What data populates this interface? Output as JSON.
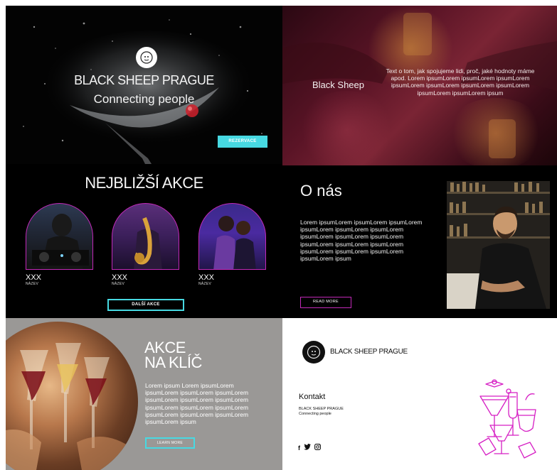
{
  "hero": {
    "title": "BLACK SHEEP PRAGUE",
    "subtitle": "Connecting people",
    "reserve_label": "REZERVACE",
    "logo_icon": "sheep-logo-icon"
  },
  "banner": {
    "brand": "Black Sheep",
    "text": "Text o tom, jak spojujeme lidi, proč, jaké hodnoty máme apod. Lorem ipsumLorem ipsumLorem ipsumLorem ipsumLorem ipsumLorem ipsumLorem ipsumLorem ipsumLorem ipsumLorem ipsum"
  },
  "events": {
    "heading": "NEJBLIŽŠÍ AKCE",
    "cards": [
      {
        "name": "XXX",
        "label": "NÁZEV"
      },
      {
        "name": "XXX",
        "label": "NÁZEV"
      },
      {
        "name": "XXX",
        "label": "NÁZEV"
      }
    ],
    "next_label": "DALŠÍ AKCE"
  },
  "about": {
    "heading": "O nás",
    "text": "Lorem ipsumLorem ipsumLorem ipsumLorem ipsumLorem ipsumLorem ipsumLorem ipsumLorem ipsumLorem ipsumLorem ipsumLorem ipsumLorem ipsumLorem ipsumLorem ipsumLorem ipsumLorem ipsumLorem ipsum",
    "read_more_label": "READ MORE"
  },
  "private_events": {
    "heading_line1": "AKCE",
    "heading_line2": "NA KLÍČ",
    "text": "Lorem ipsum Lorem ipsumLorem ipsumLorem ipsumLorem ipsumLorem ipsumLorem ipsumLorem ipsumLorem ipsumLorem ipsumLorem ipsumLorem ipsumLorem ipsumLorem ipsumLorem ipsumLorem ipsum",
    "learn_more_label": "LEARN MORE"
  },
  "footer": {
    "brand": "BLACK SHEEP PRAGUE",
    "contact_heading": "Kontakt",
    "contact_line1": "BLACK SHEEP PRAGUE",
    "contact_line2": "Connecting people",
    "social": [
      "f",
      "t",
      "i"
    ]
  },
  "colors": {
    "accent_cyan": "#47d9e2",
    "accent_magenta": "#c229b8",
    "bg_dark": "#000000",
    "bg_grey": "#9a9896"
  }
}
